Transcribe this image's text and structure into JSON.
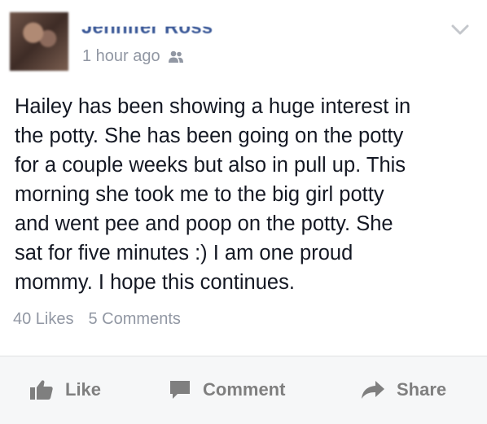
{
  "post": {
    "author": "Jennifer Ross",
    "timestamp": "1 hour ago",
    "audience_icon": "friends-icon",
    "body": "Hailey has been showing a huge interest in\nthe potty.  She has been going on the potty\nfor a couple weeks but also in pull up.  This\nmorning she took me to the big girl potty\nand went pee and poop on the potty.  She\nsat for five minutes :)  I am one proud\nmommy.  I hope this continues.",
    "likes": "40 Likes",
    "comments": "5 Comments"
  },
  "actions": {
    "like": "Like",
    "comment": "Comment",
    "share": "Share"
  },
  "colors": {
    "name": "#3b5998",
    "meta": "#9197a3",
    "text": "#141823",
    "action": "#7f7f7f",
    "action_bar_bg": "#f6f7f8"
  }
}
